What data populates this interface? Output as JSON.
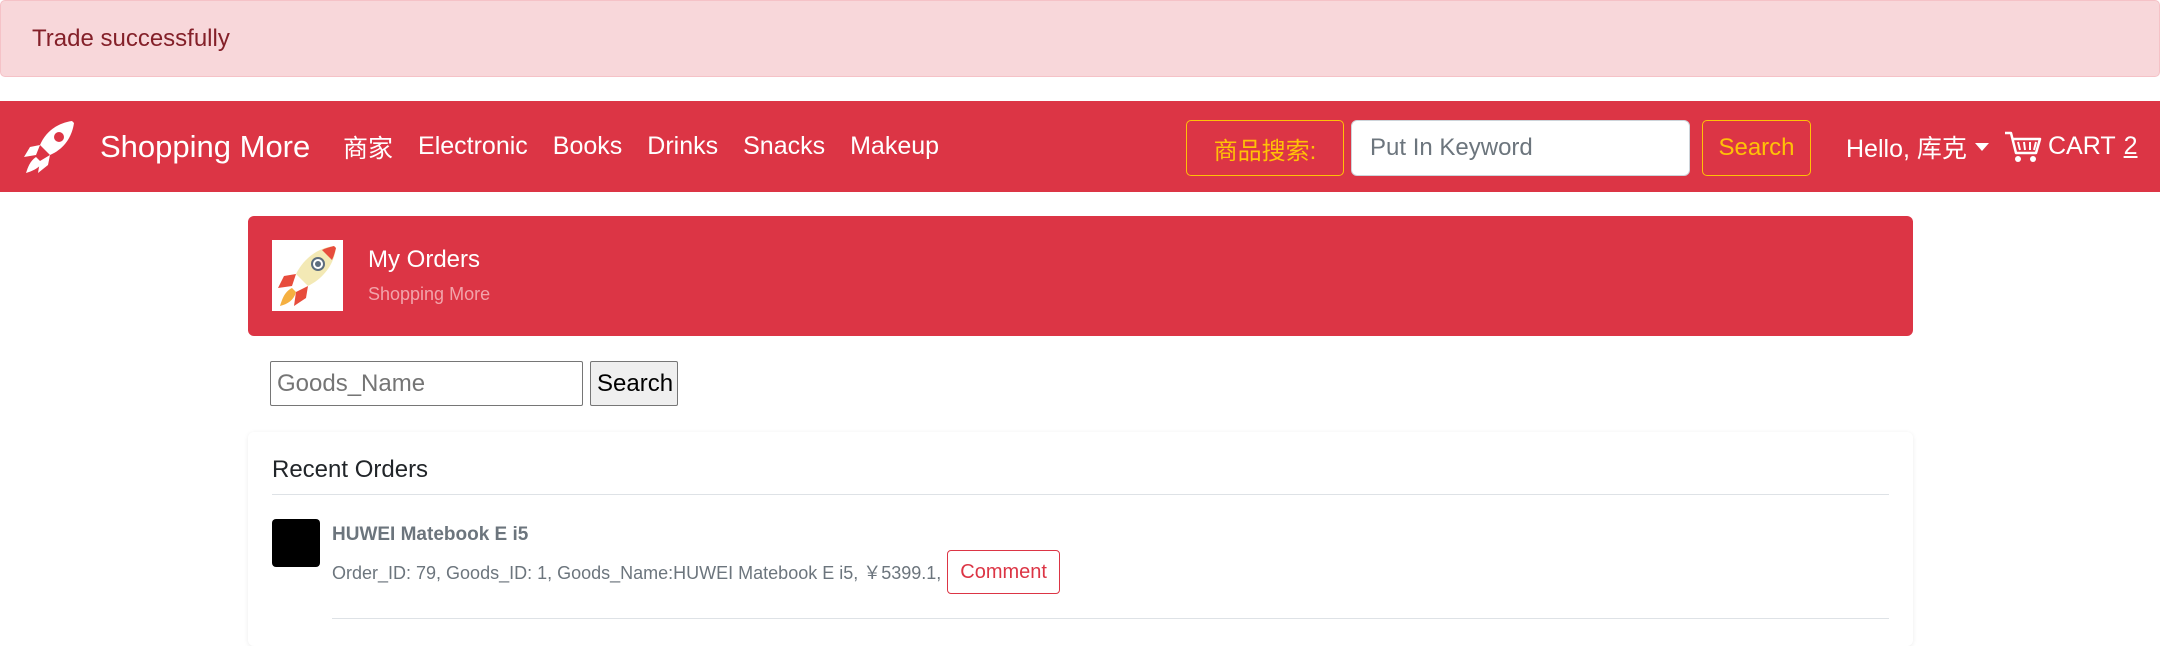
{
  "alert": {
    "text": "Trade successfully"
  },
  "navbar": {
    "brand": "Shopping More",
    "links": [
      "商家",
      "Electronic",
      "Books",
      "Drinks",
      "Snacks",
      "Makeup"
    ],
    "search_label": "商品搜索:",
    "search_placeholder": "Put In Keyword",
    "search_button": "Search",
    "user_greeting": "Hello, 库克",
    "cart_label": "CART",
    "cart_count": "2"
  },
  "page_header": {
    "title": "My Orders",
    "subtitle": "Shopping More"
  },
  "goods_search": {
    "placeholder": "Goods_Name",
    "button": "Search"
  },
  "orders": {
    "heading": "Recent Orders",
    "items": [
      {
        "name": "HUWEI Matebook E i5",
        "details": "Order_ID: 79, Goods_ID: 1, Goods_Name:HUWEI Matebook E i5, ￥5399.1,",
        "comment_label": "Comment"
      }
    ]
  },
  "colors": {
    "primary": "#dc3545",
    "warning": "#ffc107",
    "alert_bg": "#f8d7da",
    "alert_text": "#842029"
  }
}
